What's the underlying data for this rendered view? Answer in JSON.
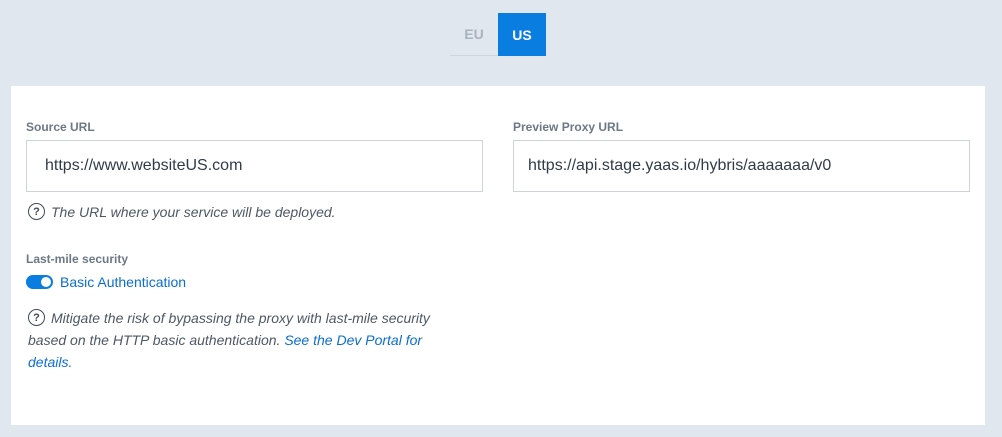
{
  "region_tabs": [
    {
      "label": "EU",
      "active": false
    },
    {
      "label": "US",
      "active": true
    }
  ],
  "source": {
    "label": "Source URL",
    "value": "https://www.websiteUS.com",
    "help": "The URL where your service will be deployed."
  },
  "proxy": {
    "label": "Preview Proxy URL",
    "value": "https://api.stage.yaas.io/hybris/aaaaaaa/v0"
  },
  "security": {
    "label": "Last-mile security",
    "toggle_label": "Basic Authentication",
    "toggle_on": true,
    "help_text": "Mitigate the risk of bypassing the proxy with last-mile security based on the HTTP basic authentication.",
    "help_link": "See the Dev Portal for details."
  },
  "icons": {
    "help": "?"
  },
  "colors": {
    "accent": "#0a7ee0",
    "background": "#e1e7ee",
    "panel": "#ffffff"
  }
}
